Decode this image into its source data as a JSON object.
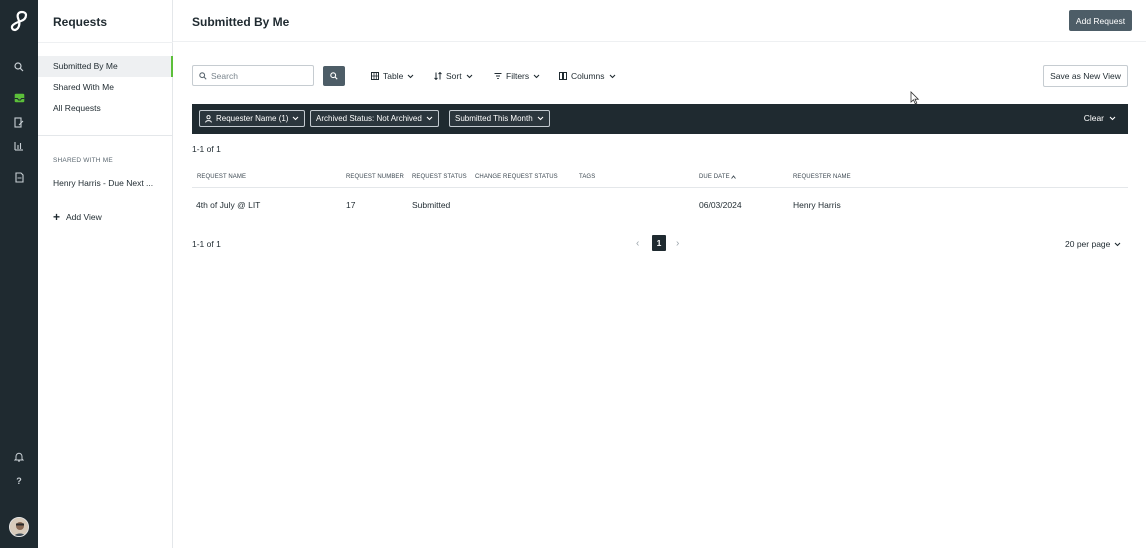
{
  "sidebar": {
    "title": "Requests",
    "nav": [
      {
        "label": "Submitted By Me",
        "active": true
      },
      {
        "label": "Shared With Me",
        "active": false
      },
      {
        "label": "All Requests",
        "active": false
      }
    ],
    "shared_heading": "SHARED WITH ME",
    "shared_items": [
      "Henry Harris - Due Next ..."
    ],
    "add_view_label": "Add View"
  },
  "header": {
    "title": "Submitted By Me",
    "add_request_label": "Add Request"
  },
  "toolbar": {
    "search_placeholder": "Search",
    "table_label": "Table",
    "sort_label": "Sort",
    "filters_label": "Filters",
    "columns_label": "Columns",
    "save_view_label": "Save as New View"
  },
  "filters": {
    "chips": [
      "Requester Name (1)",
      "Archived Status: Not Archived",
      "Submitted This Month"
    ],
    "clear_label": "Clear"
  },
  "table": {
    "count_top": "1-1 of 1",
    "count_bottom": "1-1 of 1",
    "columns": [
      "REQUEST NAME",
      "REQUEST NUMBER",
      "REQUEST STATUS",
      "CHANGE REQUEST STATUS",
      "TAGS",
      "DUE DATE",
      "REQUESTER NAME"
    ],
    "rows": [
      {
        "request_name": "4th of July @ LIT",
        "request_number": "17",
        "request_status": "Submitted",
        "change_request_status": "",
        "tags": "",
        "due_date": "06/03/2024",
        "requester_name": "Henry Harris"
      }
    ]
  },
  "pagination": {
    "current_page": "1",
    "per_page_label": "20 per page"
  },
  "colors": {
    "rail": "#1f2a30",
    "accent_green": "#5cbf3a",
    "button_dark": "#4d5d67"
  }
}
